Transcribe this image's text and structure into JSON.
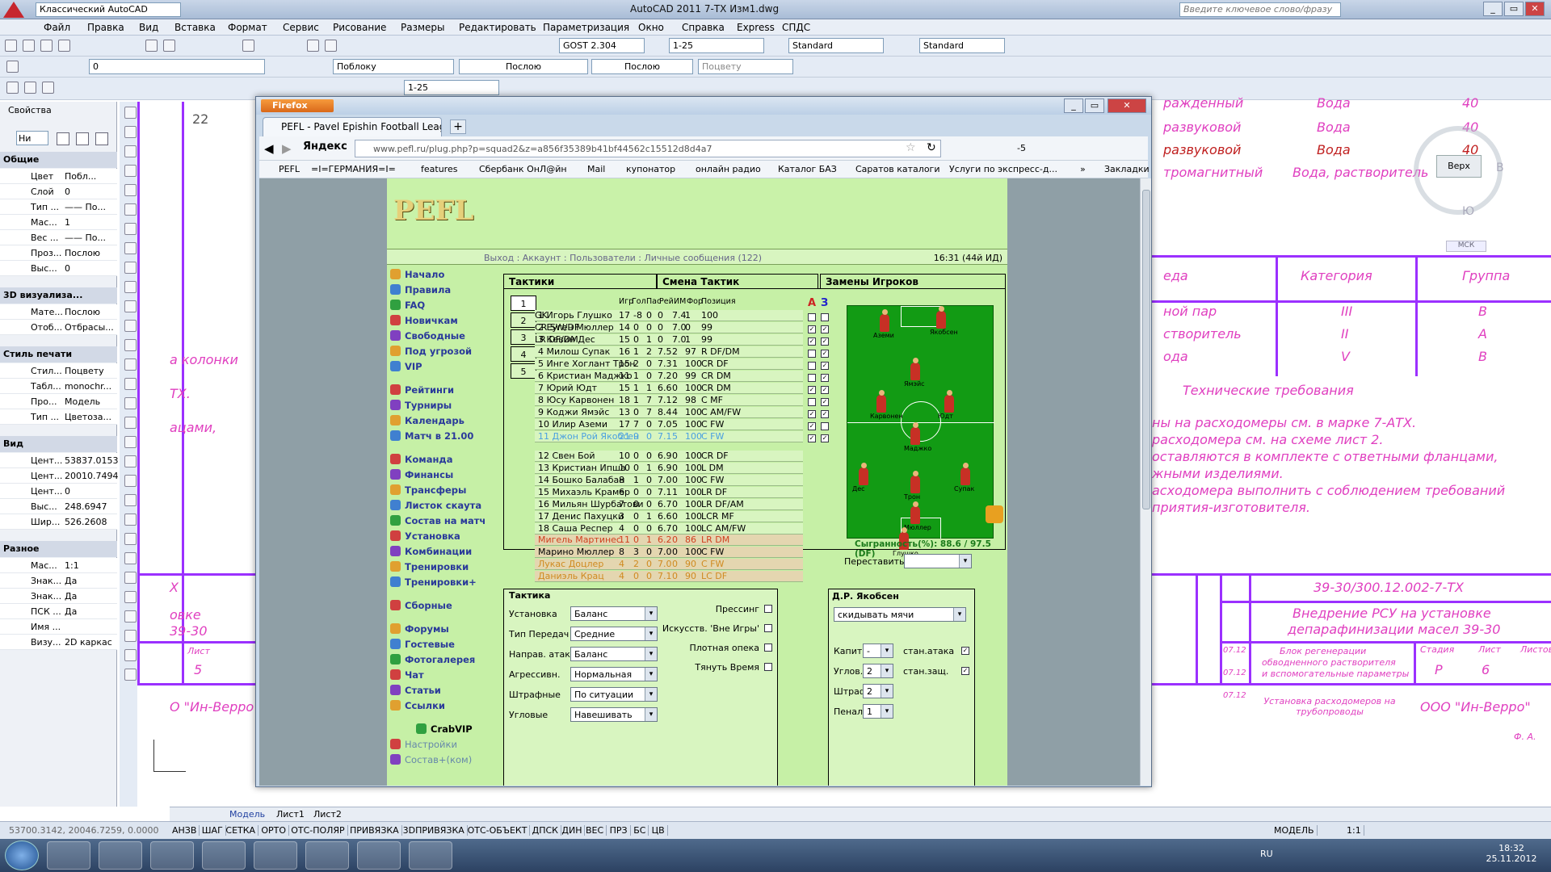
{
  "acad": {
    "workspace": "Классический AutoCAD",
    "title": "AutoCAD 2011    7-ТХ Изм1.dwg",
    "search_placeholder": "Введите ключевое слово/фразу",
    "menu": [
      "Файл",
      "Правка",
      "Вид",
      "Вставка",
      "Формат",
      "Сервис",
      "Рисование",
      "Размеры",
      "Редактировать",
      "Параметризация",
      "Окно",
      "Справка",
      "Express",
      "СПДС"
    ],
    "toolbar1": {
      "textstyle": "GOST 2.304",
      "dimscale": "1-25",
      "dimstyle": "Standard",
      "tablestyle": "Standard"
    },
    "toolbar2": {
      "layer": "0",
      "color": "Поблоку",
      "linetype": "Послою",
      "lineweight": "Послою",
      "plotstyle": "Поцвету"
    },
    "toolbar3": {
      "scale": "1-25"
    },
    "properties": {
      "title": "Свойства",
      "selector": "Ни",
      "sections": [
        {
          "name": "Общие",
          "rows": [
            [
              "Цвет",
              "Побл..."
            ],
            [
              "Слой",
              "0"
            ],
            [
              "Тип ...",
              "—— По..."
            ],
            [
              "Мас...",
              "1"
            ],
            [
              "Вес ...",
              "—— По..."
            ],
            [
              "Проз...",
              "Послою"
            ],
            [
              "Выс...",
              "0"
            ]
          ]
        },
        {
          "name": "3D визуализа...",
          "rows": [
            [
              "Мате...",
              "Послою"
            ],
            [
              "Отоб...",
              "Отбрасы..."
            ]
          ]
        },
        {
          "name": "Стиль печати",
          "rows": [
            [
              "Стил...",
              "Поцвету"
            ],
            [
              "Табл...",
              "monochr..."
            ],
            [
              "Про...",
              "Модель"
            ],
            [
              "Тип ...",
              "Цветоза..."
            ]
          ]
        },
        {
          "name": "Вид",
          "rows": [
            [
              "Цент...",
              "53837.0153"
            ],
            [
              "Цент...",
              "20010.7494"
            ],
            [
              "Цент...",
              "0"
            ],
            [
              "Выс...",
              "248.6947"
            ],
            [
              "Шир...",
              "526.2608"
            ]
          ]
        },
        {
          "name": "Разное",
          "rows": [
            [
              "Мас...",
              "1:1"
            ],
            [
              "Знак...",
              "Да"
            ],
            [
              "Знак...",
              "Да"
            ],
            [
              "ПСК ...",
              "Да"
            ],
            [
              "Имя ...",
              ""
            ],
            [
              "Визу...",
              "2D каркас"
            ]
          ]
        }
      ]
    },
    "drawing": {
      "num22": "22",
      "row1": "ражденный",
      "row1b": "Вода",
      "row1c": "40",
      "row2": "развуковой",
      "row2b": "Вода",
      "row2c": "40",
      "row3": "развуковой",
      "row3b": "Вода",
      "row3c": "40",
      "row4": "тромагнитный",
      "row4b": "Вода, растворитель",
      "row4c": "40",
      "viewcube": "Верх",
      "viewcube_s": "Ю",
      "viewcube_b": "В",
      "wcs": "МСК",
      "hdr_a": "еда",
      "hdr_b": "Категория",
      "hdr_c": "Группа",
      "t1a": "ной пар",
      "t1b": "III",
      "t1c": "В",
      "t2a": "створитель",
      "t2b": "II",
      "t2c": "А",
      "t3a": "ода",
      "t3b": "V",
      "t3c": "В",
      "tech_title": "Технические требования",
      "tech": [
        "ны на расходомеры см. в марке 7-АТХ.",
        "расходомера см. на схеме лист 2.",
        "оставляются в комплекте с ответными фланцами,",
        "жными изделиями.",
        "асходомера выполнить с соблюдением требований",
        "приятия-изготовителя."
      ],
      "left1": "а колонки",
      "left2": "ТХ.",
      "left3": "ацами,",
      "code": "39-30/300.12.002-7-ТХ",
      "proj1": "Внедрение РСУ на установке",
      "proj2": "депарафинизации масел 39-30",
      "block1": "Блок регенерации",
      "block2": "обводненного растворителя",
      "block3": "и вспомогательные параметры",
      "stage_h": "Стадия",
      "sheet_h": "Лист",
      "sheets_h": "Листов",
      "stage": "Р",
      "sheet": "6",
      "install": "Установка расходомеров на трубопроводы",
      "company": "ООО \"Ин-Верро\"",
      "date1": "07.12",
      "date2": "07.12",
      "date3": "07.12",
      "left_x": "Х",
      "left_ovke": "овке",
      "left_3930": "39-30",
      "left_list": "Лист",
      "left_5": "5",
      "left_company": "О \"Ин-Верро",
      "fa": "Ф. А."
    },
    "layout_tabs": [
      "Модель",
      "Лист1",
      "Лист2"
    ],
    "coords_readout": "53700.3142, 20046.7259, 0.0000",
    "status_buttons": [
      "АНЗВ",
      "ШАГ",
      "СЕТКА",
      "ОРТО",
      "ОТС-ПОЛЯР",
      "ПРИВЯЗКА",
      "3DПРИВЯЗКА",
      "ОТС-ОБЪЕКТ",
      "ДПСК",
      "ДИН",
      "ВЕС",
      "ПРЗ",
      "БС",
      "ЦВ"
    ],
    "status_right": [
      "МОДЕЛЬ",
      "1:1"
    ]
  },
  "taskbar": {
    "lang": "RU",
    "time": "18:32",
    "date": "25.11.2012"
  },
  "firefox": {
    "menu_button": "Firefox",
    "tab_title": "PEFL - Pavel Epishin Football League",
    "new_tab": "+",
    "search_engine": "Яндекс",
    "url": "www.pefl.ru/plug.php?p=squad2&z=a856f35389b41bf44562c15512d8d4a7",
    "zoom": "-5",
    "bookmarks": [
      "PEFL",
      "=I=ГЕРМАНИЯ=I=",
      "features",
      "Сбербанк ОнЛ@йн",
      "Mail",
      "купонатор",
      "онлайн радио",
      "Каталог БАЗ",
      "Саратов каталоги",
      "Услуги по экспресс-д..."
    ],
    "bookmarks_more": "»",
    "bookmarks_folder": "Закладки"
  },
  "pefl": {
    "logo": "PEFL",
    "nav_links": "Выход : Аккаунт : Пользователи : Личные сообщения (122)",
    "clock": "16:31 (44й ИД)",
    "menu": [
      "Начало",
      "Правила",
      "FAQ",
      "Новичкам",
      "Свободные",
      "Под угрозой",
      "VIP",
      "",
      "Рейтинги",
      "Турниры",
      "Календарь",
      "Матч в 21.00",
      "",
      "Команда",
      "Финансы",
      "Трансферы",
      "Листок скаута",
      "Состав на матч",
      "Установка",
      "Комбинации",
      "Тренировки",
      "Тренировки+",
      "",
      "Сборные",
      "",
      "Форумы",
      "Гостевые",
      "Фотогалерея",
      "Чат",
      "Статьи",
      "Ссылки",
      "",
      "CrabVIP",
      "Настройки",
      "Состав+(ком)"
    ],
    "tabs": [
      "Тактики",
      "Смена Тактик",
      "Замены Игроков"
    ],
    "squad_tabs": [
      "1",
      "2",
      "3",
      "4",
      "5"
    ],
    "headers": [
      "Игр",
      "Гол",
      "Пас",
      "Рей",
      "ИМ",
      "Фор",
      "Позиция"
    ],
    "col_a": "A",
    "col_3": "З",
    "starters": [
      [
        "1 Игорь Глушко",
        "17",
        "-8",
        "0",
        "0",
        "7.4",
        "1",
        "100",
        "GK"
      ],
      [
        "2 Еуген Мюллер",
        "14",
        "0",
        "0",
        "0",
        "7.0",
        "0",
        "99",
        "CR SW/DF"
      ],
      [
        "3 Кевин Дес",
        "15",
        "0",
        "1",
        "0",
        "7.0",
        "1",
        "99",
        "LR DF/DM"
      ],
      [
        "4 Милош Супак",
        "16",
        "1",
        "2",
        "7.5",
        "2",
        "97",
        "R DF/DM"
      ],
      [
        "5 Инге Хоглант Трон",
        "15",
        "2",
        "0",
        "7.3",
        "1",
        "100",
        "CR DF"
      ],
      [
        "6 Кристиан Маджко",
        "11",
        "1",
        "0",
        "7.2",
        "0",
        "99",
        "CR DM"
      ],
      [
        "7 Юрий Юдт",
        "15",
        "1",
        "1",
        "6.6",
        "0",
        "100",
        "CR DM"
      ],
      [
        "8 Юсу Карвонен",
        "18",
        "1",
        "7",
        "7.1",
        "2",
        "98",
        "C MF"
      ],
      [
        "9 Коджи Ямэйс",
        "13",
        "0",
        "7",
        "8.4",
        "4",
        "100",
        "C AM/FW"
      ],
      [
        "10 Илир Аземи",
        "17",
        "7",
        "0",
        "7.0",
        "5",
        "100",
        "C FW"
      ],
      [
        "11 Джон Рой Якобсен",
        "21",
        "9",
        "0",
        "7.1",
        "5",
        "100",
        "C FW"
      ]
    ],
    "subs": [
      [
        "12 Свен Бой",
        "10",
        "0",
        "0",
        "6.9",
        "0",
        "100",
        "CR DF"
      ],
      [
        "13 Кристиан Ипша",
        "10",
        "0",
        "1",
        "6.9",
        "0",
        "100",
        "L DM"
      ],
      [
        "14 Бошко Балабан",
        "8",
        "1",
        "0",
        "7.0",
        "0",
        "100",
        "C FW"
      ],
      [
        "15 Михаэль Крамер",
        "6",
        "0",
        "0",
        "7.1",
        "1",
        "100",
        "LR DF"
      ],
      [
        "16 Мильян Шурбатови",
        "7",
        "0",
        "0",
        "6.7",
        "0",
        "100",
        "LR DF/AM"
      ],
      [
        "17 Денис Пахуцки",
        "3",
        "0",
        "1",
        "6.6",
        "0",
        "100",
        "LCR MF"
      ],
      [
        "18 Саша Респер",
        "4",
        "0",
        "0",
        "6.7",
        "0",
        "100",
        "LC AM/FW"
      ]
    ],
    "reserves": [
      [
        "Мигель Мартинес",
        "11",
        "0",
        "1",
        "6.2",
        "0",
        "86",
        "LR DM"
      ],
      [
        "Марино Мюллер",
        "8",
        "3",
        "0",
        "7.0",
        "0",
        "100",
        "C FW"
      ],
      [
        "Лукас Доцлер",
        "4",
        "2",
        "0",
        "7.0",
        "0",
        "90",
        "C FW"
      ],
      [
        "Даниэль Крац",
        "4",
        "0",
        "0",
        "7.1",
        "0",
        "90",
        "LC DF"
      ]
    ],
    "field_labels": [
      "Аземи",
      "Якобсен",
      "Ямэйс",
      "Карвонен",
      "Юдт",
      "Маджко",
      "Дес",
      "Супак",
      "Трон",
      "Мюллер",
      "Глушко"
    ],
    "played": "Сыгранность(%): 88.6 / 97.5 (DF)",
    "rearrange": "Переставить:",
    "tactics": {
      "title": "Тактика",
      "rows": [
        [
          "Установка",
          "Баланс"
        ],
        [
          "Тип Передач",
          "Средние"
        ],
        [
          "Направ. атак",
          "Баланс"
        ],
        [
          "Агрессивн.",
          "Нормальная"
        ],
        [
          "Штрафные",
          "По ситуации"
        ],
        [
          "Угловые",
          "Навешивать"
        ]
      ],
      "checks": [
        "Прессинг",
        "Искусств. 'Вне Игры'",
        "Плотная опека",
        "Тянуть Время"
      ]
    },
    "player_box": {
      "title": "Д.Р. Якобсен",
      "order": "скидывать мячи",
      "rows": [
        [
          "Капит.",
          "-"
        ],
        [
          "Углов.",
          "2"
        ],
        [
          "Штраф.",
          "2"
        ],
        [
          "Пенал.",
          "1"
        ]
      ],
      "checks": [
        "стан.атака",
        "стан.защ."
      ]
    }
  }
}
